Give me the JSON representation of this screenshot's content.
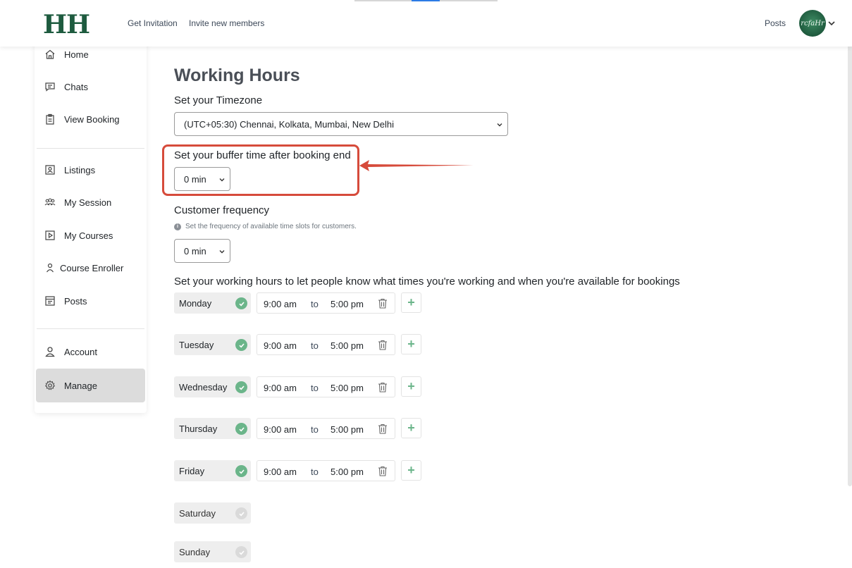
{
  "header": {
    "logo": "HH",
    "nav": [
      {
        "label": "Get Invitation"
      },
      {
        "label": "Invite new members"
      }
    ],
    "posts_label": "Posts",
    "avatar_text": "rcfaHr"
  },
  "sidebar": {
    "items": [
      {
        "label": "Home",
        "icon": "home-icon"
      },
      {
        "label": "Chats",
        "icon": "chat-icon"
      },
      {
        "label": "View Booking",
        "icon": "clipboard-icon"
      },
      {
        "label": "Listings",
        "icon": "listings-icon"
      },
      {
        "label": "My Session",
        "icon": "group-icon"
      },
      {
        "label": "My Courses",
        "icon": "play-square-icon"
      },
      {
        "label": "Course Enroller",
        "icon": "person-icon"
      },
      {
        "label": "Posts",
        "icon": "posts-icon"
      },
      {
        "label": "Account",
        "icon": "account-icon"
      },
      {
        "label": "Manage",
        "icon": "gear-icon",
        "active": true
      }
    ]
  },
  "main": {
    "title": "Working Hours",
    "timezone_label": "Set your Timezone",
    "timezone_value": "(UTC+05:30) Chennai, Kolkata, Mumbai, New Delhi",
    "buffer_label": "Set your buffer time after booking end",
    "buffer_value": "0 min",
    "frequency_label": "Customer frequency",
    "frequency_hint": "Set the frequency of available time slots for customers.",
    "frequency_value": "0 min",
    "hours_label": "Set your working hours to let people know what times you're working and when you're available for bookings",
    "to_label": "to",
    "days": [
      {
        "name": "Monday",
        "enabled": true,
        "start": "9:00 am",
        "end": "5:00 pm"
      },
      {
        "name": "Tuesday",
        "enabled": true,
        "start": "9:00 am",
        "end": "5:00 pm"
      },
      {
        "name": "Wednesday",
        "enabled": true,
        "start": "9:00 am",
        "end": "5:00 pm"
      },
      {
        "name": "Thursday",
        "enabled": true,
        "start": "9:00 am",
        "end": "5:00 pm"
      },
      {
        "name": "Friday",
        "enabled": true,
        "start": "9:00 am",
        "end": "5:00 pm"
      },
      {
        "name": "Saturday",
        "enabled": false
      },
      {
        "name": "Sunday",
        "enabled": false
      }
    ],
    "add_symbol": "+"
  },
  "colors": {
    "brand_green": "#1e5b3f",
    "check_green": "#6bb58a",
    "annotation_red": "#d64b3b",
    "active_bg": "#dcdcdc"
  }
}
